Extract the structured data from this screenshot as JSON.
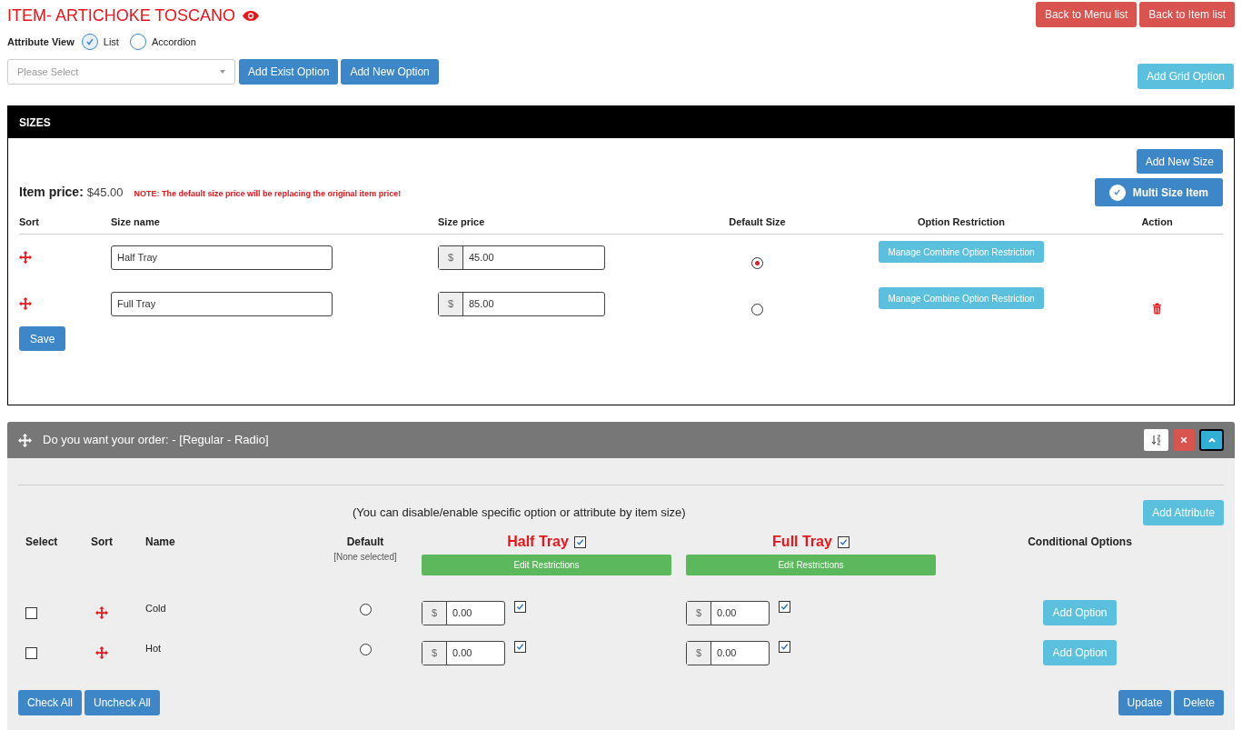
{
  "title": "ITEM- ARTICHOKE TOSCANO",
  "attribute_view": {
    "label": "Attribute View",
    "options": [
      {
        "label": "List",
        "selected": true
      },
      {
        "label": "Accordion",
        "selected": false
      }
    ]
  },
  "option_select": {
    "placeholder": "Please Select"
  },
  "option_buttons": [
    "Add Exist Option",
    "Add New Option"
  ],
  "back_buttons": [
    "Back to Menu list",
    "Back to Item list"
  ],
  "add_grid_option": "Add Grid Option",
  "sizes": {
    "title": "SIZES",
    "add_new_size": "Add New Size",
    "item_price_label": "Item price:",
    "item_price": "$45.00",
    "note": "NOTE: The default size price will be replacing the original item price!",
    "multi_size": {
      "label": "Multi Size Item",
      "checked": true
    },
    "columns": [
      "Sort",
      "Size name",
      "Size price",
      "Default Size",
      "Option Restriction",
      "Action"
    ],
    "rows": [
      {
        "name": "Half Tray",
        "currency": "$",
        "price": "45.00",
        "selected": true,
        "restriction_button": "Manage Combine Option Restriction",
        "deletable": false
      },
      {
        "name": "Full Tray",
        "currency": "$",
        "price": "85.00",
        "selected": false,
        "restriction_button": "Manage Combine Option Restriction",
        "deletable": true
      }
    ],
    "save": "Save"
  },
  "attribute": {
    "title": "Do you want your order: - [Regular - Radio]",
    "expanded": true,
    "hint": "(You can disable/enable specific option or attribute by item size)",
    "add_attribute": "Add Attribute",
    "columns": [
      "Select",
      "Sort",
      "Name",
      "Default",
      "Conditional Options"
    ],
    "default_note": "[None selected]",
    "sizes": [
      {
        "label": "Half Tray",
        "checked": true,
        "button": "Edit Restrictions"
      },
      {
        "label": "Full Tray",
        "checked": true,
        "button": "Edit Restrictions"
      }
    ],
    "rows": [
      {
        "checked": false,
        "name": "Cold",
        "selected": false,
        "prices": [
          {
            "currency": "$",
            "value": "0.00",
            "checked": true
          },
          {
            "currency": "$",
            "value": "0.00",
            "checked": true
          }
        ],
        "add_option": "Add Option"
      },
      {
        "checked": false,
        "name": "Hot",
        "selected": false,
        "prices": [
          {
            "currency": "$",
            "value": "0.00",
            "checked": true
          },
          {
            "currency": "$",
            "value": "0.00",
            "checked": true
          }
        ],
        "add_option": "Add Option"
      }
    ],
    "footer_left": [
      "Check All",
      "Uncheck All"
    ],
    "footer_right": [
      "Update",
      "Delete"
    ]
  }
}
